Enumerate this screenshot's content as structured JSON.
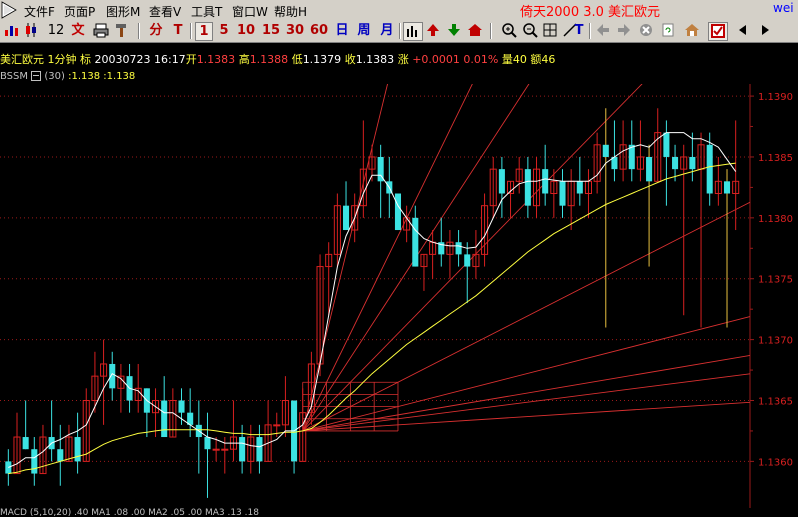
{
  "menu": {
    "items": [
      "文件F",
      "页面P",
      "图形M",
      "查看V",
      "工具T",
      "窗口W",
      "帮助H"
    ],
    "brand": "倚天2000 3.0 美汇欧元",
    "user": "wei"
  },
  "toolbar": {
    "k_count": "12",
    "text_btn": "文",
    "fen": "分",
    "tick": "T",
    "periods": [
      "1",
      "5",
      "10",
      "15",
      "30",
      "60"
    ],
    "day": "日",
    "week": "周",
    "month": "月"
  },
  "info": {
    "symbol": "美汇欧元",
    "period": "1分钟",
    "mark": "标",
    "datetime": "20030723  16:17",
    "open_label": "开",
    "open": "1.1383",
    "high_label": "高",
    "high": "1.1388",
    "low_label": "低",
    "low": "1.1379",
    "close_label": "收",
    "close": "1.1383",
    "change_label": "涨",
    "change": "+0.0001",
    "pct": "0.01%",
    "vol_label": "量",
    "vol": "40",
    "amt_label": "额",
    "amt": "46"
  },
  "indicator": {
    "name": "BSSM",
    "params": "(30)",
    "values": ":1.138  :1.138"
  },
  "colors": {
    "up": "#d82020",
    "down": "#3ce2e2",
    "ma_short": "#ffffff",
    "ma_long": "#ffff40",
    "fan": "#d83030",
    "grid": "#9a1a1a",
    "axis_text": "#d82020",
    "neutral": "#e8c040"
  },
  "chart_data": {
    "type": "candlestick",
    "y_ticks": [
      1.139,
      1.1385,
      1.138,
      1.1375,
      1.137,
      1.1365,
      1.136
    ],
    "y_tick_labels": [
      "1.1390",
      "1.1385",
      "1.1380",
      "1.1375",
      "1.1370",
      "1.1365",
      "1.1360"
    ],
    "ylim": [
      1.13565,
      1.13905
    ],
    "ohlc": [
      [
        1.136,
        1.1361,
        1.1358,
        1.1359
      ],
      [
        1.1359,
        1.1364,
        1.1359,
        1.1362
      ],
      [
        1.1362,
        1.1365,
        1.1361,
        1.1361
      ],
      [
        1.1361,
        1.1362,
        1.1358,
        1.1359
      ],
      [
        1.1359,
        1.1363,
        1.1359,
        1.1362
      ],
      [
        1.1362,
        1.1365,
        1.136,
        1.1361
      ],
      [
        1.1361,
        1.1363,
        1.1358,
        1.136
      ],
      [
        1.136,
        1.1363,
        1.136,
        1.1362
      ],
      [
        1.1362,
        1.1364,
        1.1359,
        1.136
      ],
      [
        1.136,
        1.1366,
        1.136,
        1.1365
      ],
      [
        1.1365,
        1.1369,
        1.1364,
        1.1367
      ],
      [
        1.1367,
        1.137,
        1.1363,
        1.1368
      ],
      [
        1.1368,
        1.1369,
        1.1365,
        1.1366
      ],
      [
        1.1366,
        1.1368,
        1.1364,
        1.1367
      ],
      [
        1.1367,
        1.1368,
        1.1364,
        1.1365
      ],
      [
        1.1365,
        1.1368,
        1.1364,
        1.1366
      ],
      [
        1.1366,
        1.1366,
        1.1362,
        1.1364
      ],
      [
        1.1364,
        1.1366,
        1.1362,
        1.1365
      ],
      [
        1.1365,
        1.1367,
        1.1362,
        1.1362
      ],
      [
        1.1362,
        1.1366,
        1.1362,
        1.1365
      ],
      [
        1.1365,
        1.1366,
        1.1363,
        1.1364
      ],
      [
        1.1364,
        1.1366,
        1.1362,
        1.1363
      ],
      [
        1.1363,
        1.1365,
        1.1359,
        1.1362
      ],
      [
        1.1362,
        1.1364,
        1.1357,
        1.1361
      ],
      [
        1.1361,
        1.1362,
        1.136,
        1.1361
      ],
      [
        1.1361,
        1.1362,
        1.1359,
        1.1361
      ],
      [
        1.1361,
        1.1365,
        1.136,
        1.1362
      ],
      [
        1.1362,
        1.1363,
        1.1359,
        1.136
      ],
      [
        1.136,
        1.1363,
        1.1359,
        1.1362
      ],
      [
        1.1362,
        1.1363,
        1.1359,
        1.136
      ],
      [
        1.136,
        1.1365,
        1.136,
        1.1363
      ],
      [
        1.1363,
        1.1364,
        1.1362,
        1.1363
      ],
      [
        1.1363,
        1.1367,
        1.1362,
        1.1365
      ],
      [
        1.1365,
        1.1365,
        1.1359,
        1.136
      ],
      [
        1.136,
        1.1366,
        1.136,
        1.1364
      ],
      [
        1.1364,
        1.1369,
        1.1363,
        1.1368
      ],
      [
        1.1368,
        1.1377,
        1.1367,
        1.1376
      ],
      [
        1.1376,
        1.1378,
        1.1372,
        1.1377
      ],
      [
        1.1377,
        1.1382,
        1.1376,
        1.1381
      ],
      [
        1.1381,
        1.1383,
        1.1379,
        1.1379
      ],
      [
        1.1379,
        1.1382,
        1.1378,
        1.1381
      ],
      [
        1.1381,
        1.1388,
        1.138,
        1.1384
      ],
      [
        1.1384,
        1.1386,
        1.1383,
        1.1385
      ],
      [
        1.1385,
        1.1386,
        1.138,
        1.1383
      ],
      [
        1.1383,
        1.1385,
        1.138,
        1.1382
      ],
      [
        1.1382,
        1.1382,
        1.1379,
        1.1379
      ],
      [
        1.1379,
        1.1381,
        1.1378,
        1.138
      ],
      [
        1.138,
        1.1381,
        1.1376,
        1.1376
      ],
      [
        1.1376,
        1.1377,
        1.1374,
        1.1377
      ],
      [
        1.1377,
        1.1379,
        1.1375,
        1.1378
      ],
      [
        1.1378,
        1.138,
        1.1376,
        1.1377
      ],
      [
        1.1377,
        1.1379,
        1.1375,
        1.1378
      ],
      [
        1.1378,
        1.1379,
        1.1376,
        1.1377
      ],
      [
        1.1377,
        1.1378,
        1.1373,
        1.1376
      ],
      [
        1.1376,
        1.1379,
        1.1375,
        1.1377
      ],
      [
        1.1377,
        1.1382,
        1.1376,
        1.1381
      ],
      [
        1.1381,
        1.1385,
        1.138,
        1.1384
      ],
      [
        1.1384,
        1.1385,
        1.138,
        1.1382
      ],
      [
        1.1382,
        1.1383,
        1.138,
        1.1383
      ],
      [
        1.1383,
        1.1385,
        1.1382,
        1.1384
      ],
      [
        1.1384,
        1.1385,
        1.138,
        1.1381
      ],
      [
        1.1381,
        1.1385,
        1.138,
        1.1384
      ],
      [
        1.1384,
        1.1386,
        1.1381,
        1.1382
      ],
      [
        1.1382,
        1.1384,
        1.138,
        1.1383
      ],
      [
        1.1383,
        1.1384,
        1.138,
        1.1381
      ],
      [
        1.1381,
        1.1384,
        1.1379,
        1.1383
      ],
      [
        1.1383,
        1.1385,
        1.1381,
        1.1382
      ],
      [
        1.1382,
        1.1384,
        1.138,
        1.1383
      ],
      [
        1.1383,
        1.1387,
        1.1382,
        1.1386
      ],
      [
        1.1386,
        1.1389,
        1.1371,
        1.1385
      ],
      [
        1.1385,
        1.1388,
        1.1383,
        1.1384
      ],
      [
        1.1384,
        1.1388,
        1.1383,
        1.1386
      ],
      [
        1.1386,
        1.1388,
        1.1383,
        1.1384
      ],
      [
        1.1384,
        1.1388,
        1.1383,
        1.1385
      ],
      [
        1.1385,
        1.1386,
        1.1376,
        1.1383
      ],
      [
        1.1383,
        1.1389,
        1.1383,
        1.1387
      ],
      [
        1.1387,
        1.1388,
        1.1381,
        1.1385
      ],
      [
        1.1385,
        1.1386,
        1.1383,
        1.1384
      ],
      [
        1.1384,
        1.1386,
        1.1372,
        1.1385
      ],
      [
        1.1385,
        1.1387,
        1.1383,
        1.1384
      ],
      [
        1.1384,
        1.1387,
        1.1371,
        1.1386
      ],
      [
        1.1386,
        1.1387,
        1.1381,
        1.1382
      ],
      [
        1.1382,
        1.1385,
        1.1381,
        1.1383
      ],
      [
        1.1383,
        1.1384,
        1.1371,
        1.1382
      ],
      [
        1.1382,
        1.1388,
        1.1379,
        1.1383
      ]
    ],
    "ma_short": [
      1.13595,
      1.13598,
      1.13603,
      1.13603,
      1.13608,
      1.13615,
      1.13618,
      1.13622,
      1.13625,
      1.1363,
      1.13645,
      1.1366,
      1.13672,
      1.13668,
      1.1366,
      1.13658,
      1.1365,
      1.13645,
      1.1364,
      1.1364,
      1.13635,
      1.1363,
      1.13625,
      1.1362,
      1.13618,
      1.13615,
      1.13615,
      1.13615,
      1.13613,
      1.13612,
      1.13615,
      1.13618,
      1.13625,
      1.13625,
      1.1363,
      1.13645,
      1.1368,
      1.1372,
      1.1376,
      1.13785,
      1.138,
      1.1382,
      1.13835,
      1.13835,
      1.13825,
      1.1381,
      1.138,
      1.1379,
      1.13783,
      1.1378,
      1.13778,
      1.13777,
      1.13777,
      1.13775,
      1.13776,
      1.13785,
      1.138,
      1.13815,
      1.13822,
      1.13828,
      1.1383,
      1.1383,
      1.13832,
      1.13831,
      1.1383,
      1.1383,
      1.1383,
      1.1383,
      1.13835,
      1.13845,
      1.1385,
      1.13855,
      1.13858,
      1.1386,
      1.13858,
      1.13865,
      1.1387,
      1.1387,
      1.1387,
      1.13865,
      1.13865,
      1.13862,
      1.13858,
      1.13848,
      1.13838
    ],
    "ma_long": [
      1.1359,
      1.13591,
      1.13593,
      1.13594,
      1.13596,
      1.13598,
      1.136,
      1.13602,
      1.13604,
      1.13606,
      1.1361,
      1.13614,
      1.13617,
      1.13619,
      1.13621,
      1.13623,
      1.13624,
      1.13625,
      1.13626,
      1.13626,
      1.13626,
      1.13626,
      1.13626,
      1.13626,
      1.13625,
      1.13624,
      1.13623,
      1.13623,
      1.13622,
      1.13622,
      1.13622,
      1.13623,
      1.13624,
      1.13624,
      1.13625,
      1.13627,
      1.13632,
      1.13638,
      1.13645,
      1.13652,
      1.13658,
      1.13665,
      1.13672,
      1.13678,
      1.13684,
      1.1369,
      1.13696,
      1.13701,
      1.13706,
      1.13711,
      1.13716,
      1.13721,
      1.13726,
      1.13731,
      1.13736,
      1.13742,
      1.13748,
      1.13754,
      1.1376,
      1.13766,
      1.13772,
      1.13777,
      1.13782,
      1.13787,
      1.13791,
      1.13795,
      1.13799,
      1.13803,
      1.13807,
      1.13811,
      1.13814,
      1.13817,
      1.1382,
      1.13823,
      1.13826,
      1.13829,
      1.13832,
      1.13834,
      1.13836,
      1.13838,
      1.1384,
      1.13842,
      1.13843,
      1.13844,
      1.13845
    ],
    "fan": {
      "origin_bar": 34,
      "origin_price": 1.13625,
      "box_bar": 45,
      "box_price": 1.13665,
      "slopes": [
        8,
        4,
        3,
        2,
        1,
        0.5,
        0.33,
        0.25,
        0.125
      ]
    }
  },
  "bottom": {
    "text": "MACD   (5,10,20)   .40   MA1   .08   .00   MA2   .05   .00   MA3   .13   .18"
  }
}
